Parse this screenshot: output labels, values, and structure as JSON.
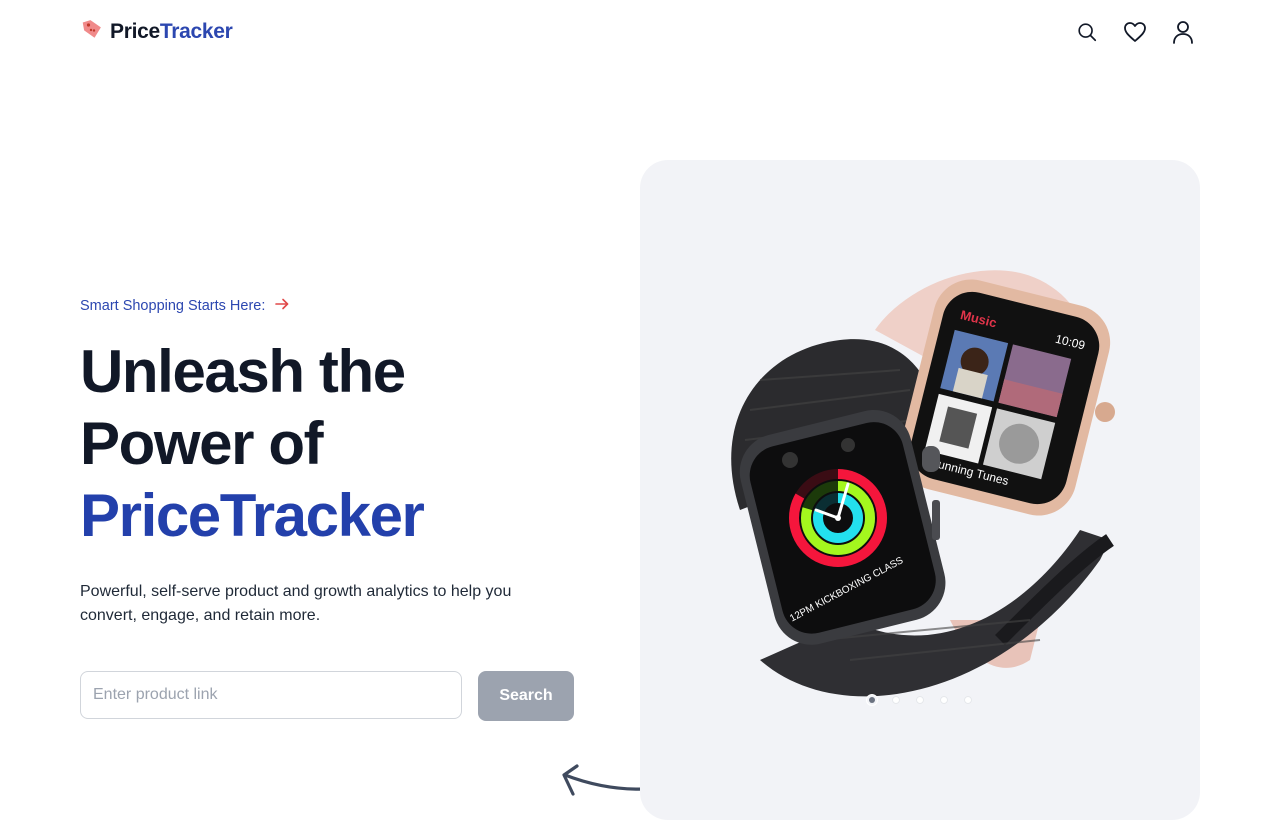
{
  "nav": {
    "brand_part1": "Price",
    "brand_part2": "Tracker",
    "icons": [
      "search-icon",
      "heart-icon",
      "user-icon"
    ]
  },
  "hero": {
    "eyebrow": "Smart Shopping Starts Here:",
    "headline_line1": "Unleash the",
    "headline_line2": "Power of",
    "headline_brand": "PriceTracker",
    "description": "Powerful, self-serve product and growth analytics to help you convert, engage, and retain more.",
    "search_placeholder": "Enter product link",
    "search_value": "",
    "search_button": "Search"
  },
  "carousel": {
    "slide_count": 5,
    "active_index": 0,
    "image": "smartwatch-product-image",
    "watch_screen_text": {
      "app": "Music",
      "time": "10:09",
      "caption": "Running Tunes",
      "class_text": "12PM KICKBOXING CLASS"
    }
  },
  "colors": {
    "brand_blue": "#2340ab",
    "dark_text": "#111827",
    "accent_red": "#e04848",
    "card_bg": "#f2f3f7",
    "button_disabled": "#9ca3af"
  }
}
